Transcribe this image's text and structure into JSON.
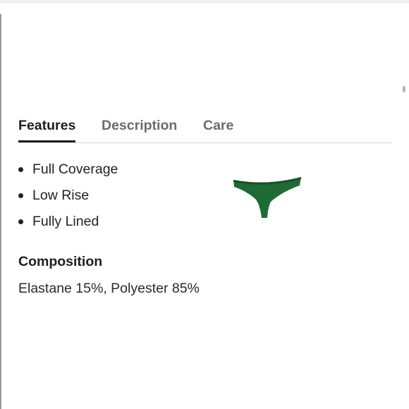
{
  "tabs": [
    {
      "label": "Features",
      "active": true
    },
    {
      "label": "Description",
      "active": false
    },
    {
      "label": "Care",
      "active": false
    }
  ],
  "features": {
    "items": [
      "Full Coverage",
      "Low Rise",
      "Fully Lined"
    ]
  },
  "composition": {
    "title": "Composition",
    "text": "Elastane 15%, Polyester 85%"
  },
  "product_image": {
    "color": "#1f6b36",
    "trim_color": "#164f28"
  },
  "colors": {
    "active_tab": "#1f1f1f",
    "inactive_tab": "#6b6b6b",
    "divider": "#d8d8d8"
  }
}
